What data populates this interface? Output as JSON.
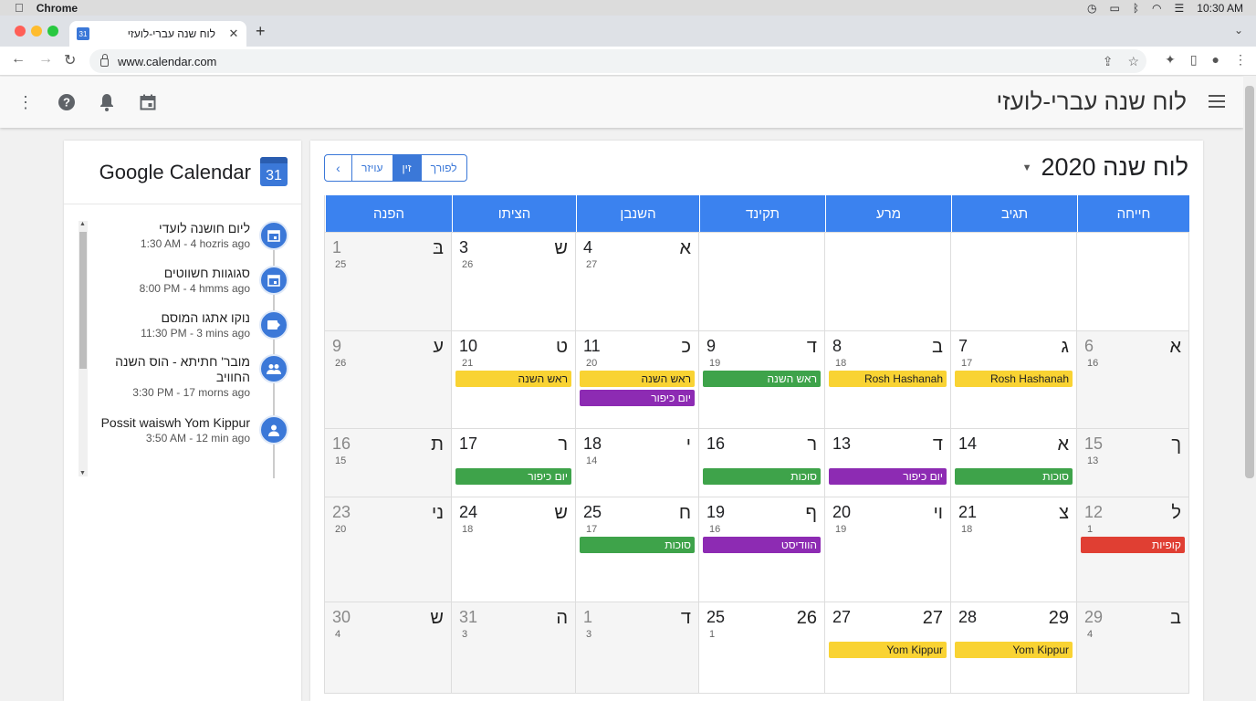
{
  "mac": {
    "app": "Chrome",
    "time": "10:30 AM"
  },
  "browser": {
    "tab_title": "לוח שנה עברי-לועזי",
    "tab_icon_text": "31",
    "url": "www.calendar.com"
  },
  "app": {
    "title": "לוח שנה עברי-לועזי"
  },
  "sidebar": {
    "title": "Google Calendar",
    "icon_text": "31",
    "items": [
      {
        "title": "ליום חושנה לועדי",
        "meta": "1:30 AM - 4 hozris ago",
        "icon": "calendar-icon"
      },
      {
        "title": "סגוגוות חשווטים",
        "meta": "8:00 PM - 4 hmms ago",
        "icon": "calendar-icon"
      },
      {
        "title": "נוקו אתגו המוסם",
        "meta": "11:30 PM - 3 mins ago",
        "icon": "event-icon"
      },
      {
        "title": "מובר' חתיתא - הוס השנה החוויב",
        "meta": "3:30 PM - 17 morns ago",
        "icon": "group-icon"
      },
      {
        "title": "Possit waiswh Yom Kippur",
        "meta": "3:50 AM - 12 min ago",
        "icon": "person-icon"
      }
    ]
  },
  "main": {
    "title": "לוח שנה 2020",
    "seg": [
      "לפורך",
      "זין",
      "עויזר"
    ],
    "days": [
      "חייחה",
      "תגיב",
      "מרע",
      "תקינד",
      "השנבן",
      "הציתו",
      "הפנה"
    ]
  },
  "calendar": {
    "weeks": [
      [
        {
          "off": false,
          "heb": "",
          "greg": "",
          "small": ""
        },
        {
          "off": false,
          "heb": "",
          "greg": "",
          "small": ""
        },
        {
          "off": false,
          "heb": "",
          "greg": "",
          "small": ""
        },
        {
          "off": false,
          "heb": "",
          "greg": "",
          "small": ""
        },
        {
          "off": false,
          "heb": "א",
          "greg": "4",
          "small": "27"
        },
        {
          "off": false,
          "heb": "ש",
          "greg": "3",
          "small": "26"
        },
        {
          "off": true,
          "heb": "בּ",
          "greg": "1",
          "small": "25"
        }
      ],
      [
        {
          "off": true,
          "heb": "א",
          "greg": "6",
          "small": "16"
        },
        {
          "off": false,
          "heb": "ג",
          "greg": "7",
          "small": "17",
          "events": [
            {
              "label": "Rosh Hashanah",
              "color": "yellow"
            }
          ]
        },
        {
          "off": false,
          "heb": "ב",
          "greg": "8",
          "small": "18",
          "events": [
            {
              "label": "Rosh Hashanah",
              "color": "yellow"
            }
          ]
        },
        {
          "off": false,
          "heb": "ד",
          "greg": "9",
          "small": "19",
          "events": [
            {
              "label": "ראש השנה",
              "color": "green"
            }
          ]
        },
        {
          "off": false,
          "heb": "כ",
          "greg": "11",
          "small": "20",
          "events": [
            {
              "label": "ראש השנה",
              "color": "yellow"
            },
            {
              "label": "יום כיפור",
              "color": "purple"
            }
          ]
        },
        {
          "off": false,
          "heb": "ט",
          "greg": "10",
          "small": "21",
          "events": [
            {
              "label": "ראש השנה",
              "color": "yellow"
            }
          ]
        },
        {
          "off": true,
          "heb": "ע",
          "greg": "9",
          "small": "26"
        }
      ],
      [
        {
          "off": true,
          "heb": "ך",
          "greg": "15",
          "small": "13"
        },
        {
          "off": false,
          "heb": "א",
          "greg": "14",
          "small": "",
          "events": [
            {
              "label": "סוכות",
              "color": "green"
            }
          ]
        },
        {
          "off": false,
          "heb": "ד",
          "greg": "13",
          "small": "",
          "events": [
            {
              "label": "יום כיפור",
              "color": "purple"
            }
          ]
        },
        {
          "off": false,
          "heb": "ר",
          "greg": "16",
          "small": "",
          "events": [
            {
              "label": "סוכות",
              "color": "green"
            }
          ]
        },
        {
          "off": false,
          "heb": "י",
          "greg": "18",
          "small": "14"
        },
        {
          "off": false,
          "heb": "ר",
          "greg": "17",
          "small": "",
          "events": [
            {
              "label": "יום כיפור",
              "color": "green"
            }
          ]
        },
        {
          "off": true,
          "heb": "ת",
          "greg": "16",
          "small": "15"
        }
      ],
      [
        {
          "off": true,
          "heb": "ל",
          "greg": "12",
          "small": "1",
          "events": [
            {
              "label": "קופיות",
              "color": "red"
            }
          ]
        },
        {
          "off": false,
          "heb": "צ",
          "greg": "21",
          "small": "18"
        },
        {
          "off": false,
          "heb": "וי",
          "greg": "20",
          "small": "19"
        },
        {
          "off": false,
          "heb": "ף",
          "greg": "19",
          "small": "16",
          "events": [
            {
              "label": "הוודיסט",
              "color": "purple"
            }
          ]
        },
        {
          "off": false,
          "heb": "ח",
          "greg": "25",
          "small": "17",
          "events": [
            {
              "label": "סוכות",
              "color": "green"
            }
          ]
        },
        {
          "off": false,
          "heb": "ש",
          "greg": "24",
          "small": "18"
        },
        {
          "off": true,
          "heb": "ני",
          "greg": "23",
          "small": "20"
        }
      ],
      [
        {
          "off": true,
          "heb": "ב",
          "greg": "29",
          "small": "4"
        },
        {
          "off": false,
          "heb": "29",
          "greg": "28",
          "small": "",
          "events": [
            {
              "label": "Yom Kippur",
              "color": "yellow"
            }
          ]
        },
        {
          "off": false,
          "heb": "27",
          "greg": "27",
          "small": "",
          "events": [
            {
              "label": "Yom Kippur",
              "color": "yellow"
            }
          ]
        },
        {
          "off": false,
          "heb": "26",
          "greg": "25",
          "small": "1"
        },
        {
          "off": true,
          "heb": "ד",
          "greg": "1",
          "small": "3"
        },
        {
          "off": true,
          "heb": "ה",
          "greg": "31",
          "small": "3"
        },
        {
          "off": true,
          "heb": "ש",
          "greg": "30",
          "small": "4"
        }
      ]
    ]
  },
  "colors": {
    "accent": "#3b82ef",
    "yellow": "#f9d333",
    "green": "#3ea34a",
    "purple": "#8d2bb3",
    "red": "#e03f33"
  }
}
